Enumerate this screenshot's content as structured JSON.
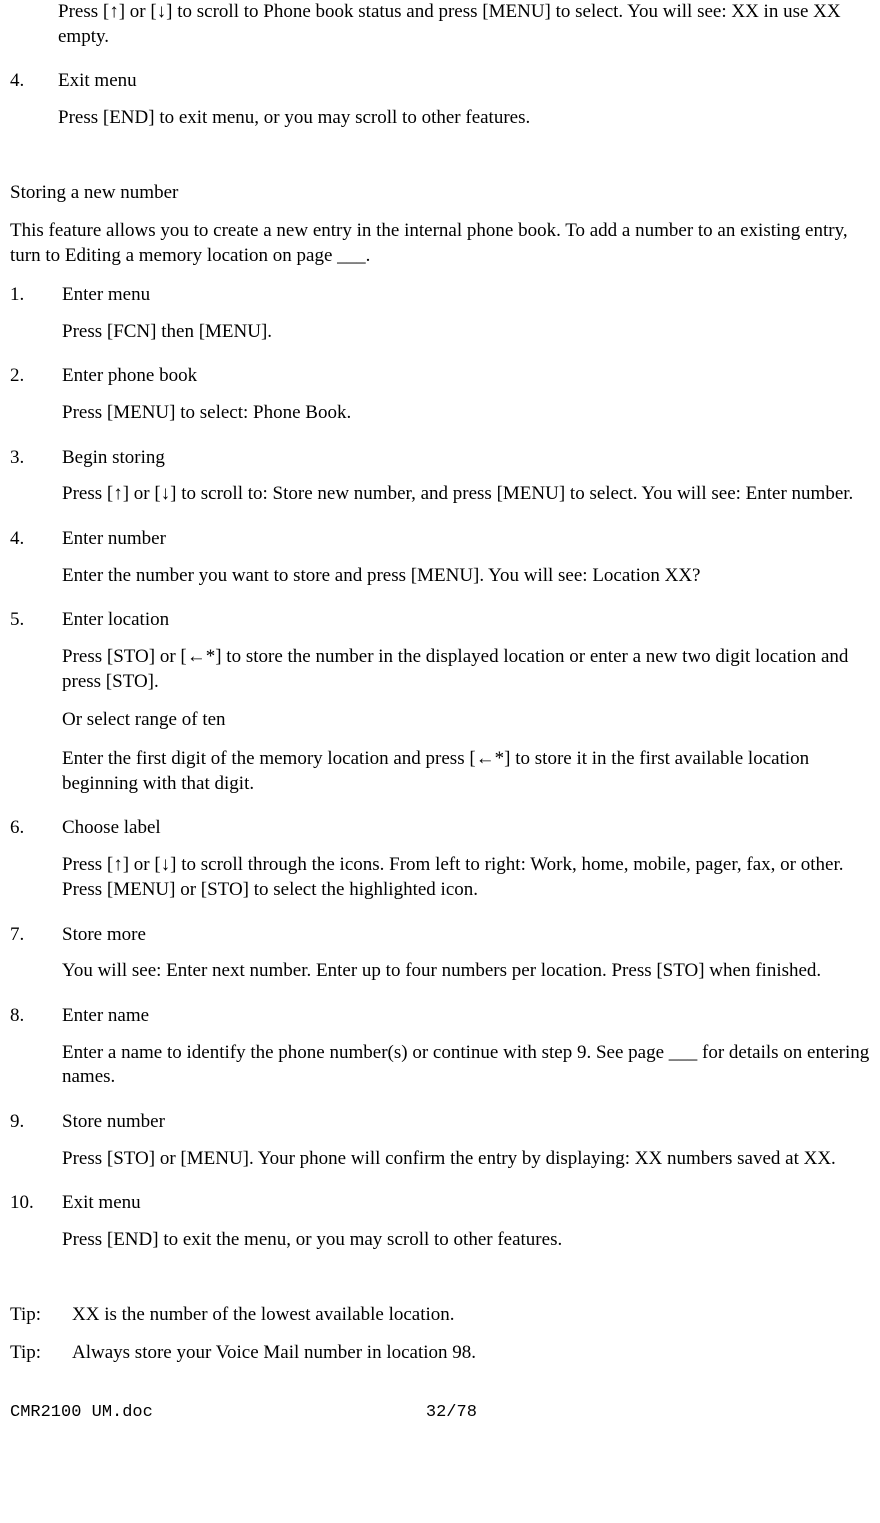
{
  "topSteps": [
    {
      "num": "",
      "title": "",
      "body": "Press [↑] or [↓] to scroll to Phone book status and press [MENU] to select. You will see: XX in use XX empty."
    },
    {
      "num": "4.",
      "title": "Exit menu",
      "body": "Press [END] to exit menu, or you may scroll to other features."
    }
  ],
  "section": {
    "heading": "Storing a new number",
    "intro": "This feature allows you to create a new entry in the internal phone book. To add a number to an existing entry, turn to Editing a memory location on page ___."
  },
  "steps": [
    {
      "num": "1.",
      "title": "Enter menu",
      "body": [
        "Press [FCN] then [MENU]."
      ]
    },
    {
      "num": "2.",
      "title": "Enter phone book",
      "body": [
        "Press [MENU] to select: Phone Book."
      ]
    },
    {
      "num": "3.",
      "title": "Begin storing",
      "body": [
        "Press [↑] or [↓] to scroll to: Store new number, and press [MENU] to select. You will see: Enter number."
      ]
    },
    {
      "num": "4.",
      "title": "Enter number",
      "body": [
        "Enter the number you want to store and press [MENU]. You will see: Location XX?"
      ]
    },
    {
      "num": "5.",
      "title": "Enter location",
      "body": [
        "Press [STO] or [←*] to store the number in the displayed location or enter a new two digit location and press [STO].",
        "Or select range of ten",
        "Enter the first digit of the memory location and press [←*] to store it in the first available location beginning with that digit."
      ]
    },
    {
      "num": "6.",
      "title": "Choose label",
      "body": [
        "Press [↑] or [↓] to scroll through the icons. From left to right: Work, home, mobile, pager, fax, or other. Press [MENU] or [STO] to select the highlighted icon."
      ]
    },
    {
      "num": "7.",
      "title": "Store more",
      "body": [
        "You will see: Enter next number. Enter up to four numbers per location. Press [STO] when finished."
      ]
    },
    {
      "num": "8.",
      "title": "Enter name",
      "body": [
        "Enter a name to identify the phone number(s) or continue with step 9. See page ___ for details on entering names."
      ]
    },
    {
      "num": "9.",
      "title": "Store number",
      "body": [
        "Press [STO] or [MENU]. Your phone will confirm the entry by displaying: XX numbers saved at XX."
      ]
    },
    {
      "num": "10.",
      "title": "Exit menu",
      "body": [
        "Press [END] to exit the menu, or you may scroll to other features."
      ]
    }
  ],
  "tips": [
    {
      "label": "Tip:",
      "text": "XX is the number of the lowest available location."
    },
    {
      "label": "Tip:",
      "text": "Always store your Voice Mail number in location 98."
    }
  ],
  "footer": {
    "left": "CMR2100 UM.doc",
    "center": "32/78"
  }
}
